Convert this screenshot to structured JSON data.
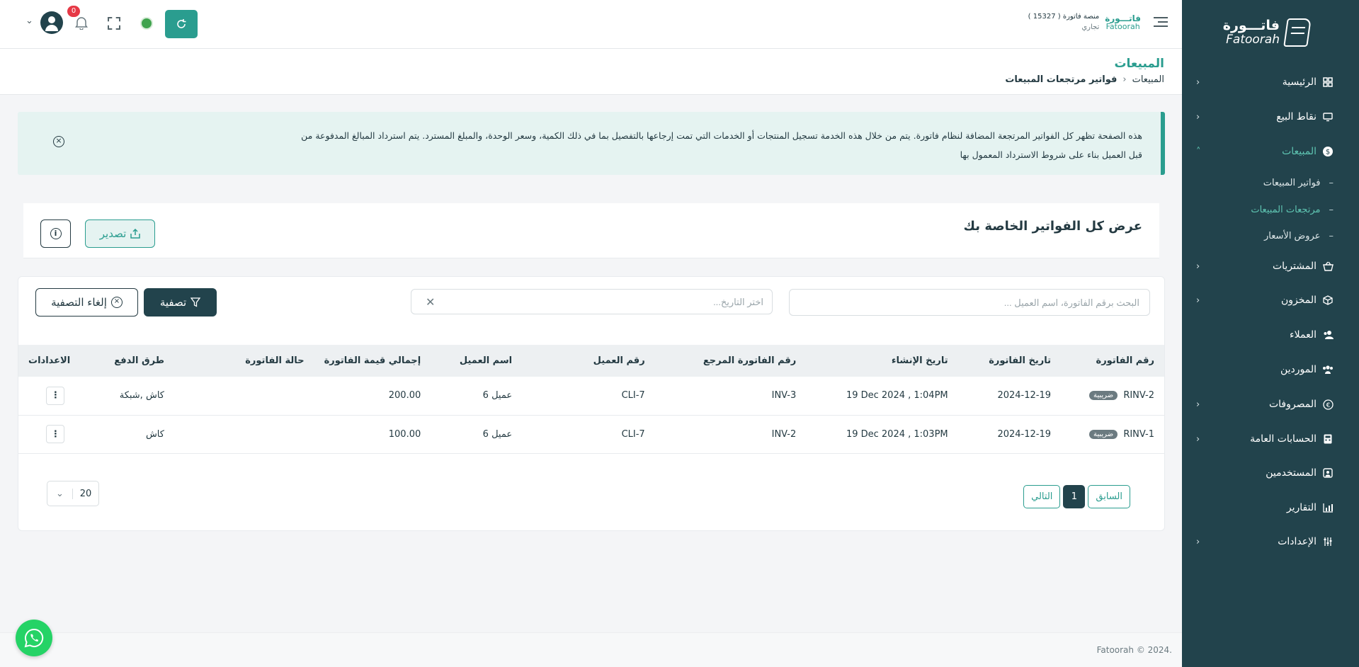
{
  "sidebar": {
    "logo_ar": "فاتـــورة",
    "logo_en": "Fatoorah",
    "items": [
      {
        "label": "الرئيسية",
        "icon": "grid-icon",
        "chevron": true
      },
      {
        "label": "نقاط البيع",
        "icon": "monitor-icon",
        "chevron": true
      },
      {
        "label": "المبيعات",
        "icon": "dollar-icon",
        "chevron": true,
        "active": true
      },
      {
        "label": "المشتريات",
        "icon": "basket-icon",
        "chevron": true
      },
      {
        "label": "المخزون",
        "icon": "box-icon",
        "chevron": true
      },
      {
        "label": "العملاء",
        "icon": "users-icon",
        "chevron": false
      },
      {
        "label": "الموردين",
        "icon": "suppliers-icon",
        "chevron": false
      },
      {
        "label": "المصروفات",
        "icon": "currency-icon",
        "chevron": true
      },
      {
        "label": "الحسابات العامة",
        "icon": "calculator-icon",
        "chevron": true
      },
      {
        "label": "المستخدمين",
        "icon": "user-card-icon",
        "chevron": false
      },
      {
        "label": "التقارير",
        "icon": "chart-icon",
        "chevron": false
      },
      {
        "label": "الإعدادات",
        "icon": "sliders-icon",
        "chevron": true
      }
    ],
    "sub_items": [
      {
        "label": "فواتير المبيعات"
      },
      {
        "label": "مرتجعات المبيعات",
        "active": true
      },
      {
        "label": "عروض الأسعار"
      }
    ]
  },
  "header": {
    "company_name": "منصة فاتورة",
    "company_id": "( 15327 )",
    "company_type": "تجاري",
    "mini_logo_ar": "فاتـــورة",
    "mini_logo_en": "Fatoorah",
    "notifications_count": "0"
  },
  "page": {
    "title": "المبيعات",
    "breadcrumb_parent": "المبيعات",
    "breadcrumb_current": "فواتير مرتجعات المبيعات"
  },
  "alert": {
    "text": "هذه الصفحة تظهر كل الفواتير المرتجعة المضافة لنظام فاتورة. يتم من خلال هذه الخدمة تسجيل المنتجات أو الخدمات التي تمت إرجاعها بالتفصيل بما في ذلك الكمية، وسعر الوحدة، والمبلغ المسترد. يتم استرداد المبالغ المدفوعة من قبل العميل بناء على شروط الاسترداد المعمول بها"
  },
  "card": {
    "title": "عرض كل الفواتير الخاصة بك",
    "export_label": "تصدير"
  },
  "filters": {
    "search_placeholder": "البحث برقم الفاتورة، اسم العميل ...",
    "date_placeholder": "اختر التاريخ...",
    "filter_label": "تصفية",
    "reset_label": "إلغاء التصفية"
  },
  "table": {
    "columns": [
      "رقم الفاتورة",
      "تاريخ الفاتورة",
      "تاريخ الإنشاء",
      "رقم الفاتورة المرجع",
      "رقم العميل",
      "اسم العميل",
      "إجمالي قيمة الفاتورة",
      "حالة الفاتورة",
      "طرق الدفع",
      "الاعدادات"
    ],
    "rows": [
      {
        "invoice_no": "RINV-2",
        "tax_badge": "ضريبية",
        "invoice_date": "2024-12-19",
        "created_at": "19 Dec 2024 , 1:04PM",
        "ref_invoice": "INV-3",
        "client_no": "CLI-7",
        "client_name": "عميل 6",
        "total": "200.00",
        "status": "",
        "payment": "كاش ,شبكة"
      },
      {
        "invoice_no": "RINV-1",
        "tax_badge": "ضريبية",
        "invoice_date": "2024-12-19",
        "created_at": "19 Dec 2024 , 1:03PM",
        "ref_invoice": "INV-2",
        "client_no": "CLI-7",
        "client_name": "عميل 6",
        "total": "100.00",
        "status": "",
        "payment": "كاش"
      }
    ]
  },
  "pagination": {
    "prev_label": "السابق",
    "current_page": "1",
    "next_label": "التالي",
    "page_size": "20"
  },
  "footer": {
    "copyright": "Fatoorah © 2024."
  },
  "colors": {
    "primary": "#2a9d8f",
    "dark": "#22434c",
    "danger": "#e63946",
    "whatsapp": "#25d366"
  }
}
